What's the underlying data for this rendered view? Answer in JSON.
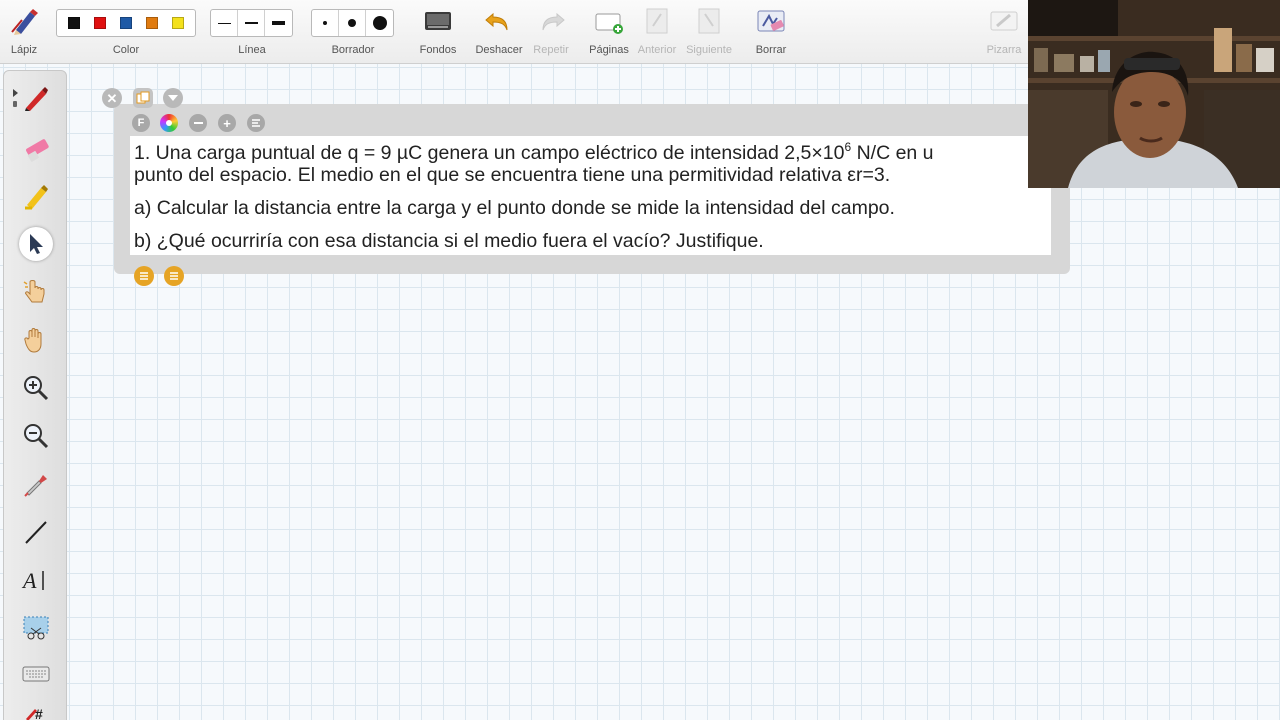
{
  "toolbar": {
    "pencil": "Lápiz",
    "color": "Color",
    "line": "Línea",
    "eraser": "Borrador",
    "backgrounds": "Fondos",
    "undo": "Deshacer",
    "redo": "Repetir",
    "pages": "Páginas",
    "previous": "Anterior",
    "next": "Siguiente",
    "clear": "Borrar",
    "board": "Pizarra"
  },
  "colors": [
    "#111111",
    "#e01010",
    "#1f5aa6",
    "#e07b10",
    "#f4e11c"
  ],
  "line_widths": [
    "thin",
    "medium",
    "thick"
  ],
  "eraser_sizes": [
    "small",
    "medium",
    "large"
  ],
  "palette_tools": [
    "pen-icon",
    "highlighter-eraser-icon",
    "marker-icon",
    "select-arrow-icon",
    "pointer-hand-icon",
    "pan-hand-icon",
    "zoom-in-icon",
    "zoom-out-icon",
    "color-picker-icon",
    "line-tool-icon",
    "text-tool-icon",
    "screenshot-icon",
    "keyboard-icon",
    "more-icon"
  ],
  "panel": {
    "format_label": "F",
    "line1_a": "1.    Una carga puntual de q = 9 µC genera un campo eléctrico de intensidad 2,5×10",
    "line1_sup": "6",
    "line1_b": " N/C en u",
    "line2": "punto del espacio. El medio en el que se encuentra tiene una permitividad relativa εr=3.",
    "line3": "a) Calcular la distancia entre la carga y el punto donde se mide la intensidad del campo.",
    "line4": "b) ¿Qué ocurriría con esa distancia si el medio fuera el vacío? Justifique."
  }
}
